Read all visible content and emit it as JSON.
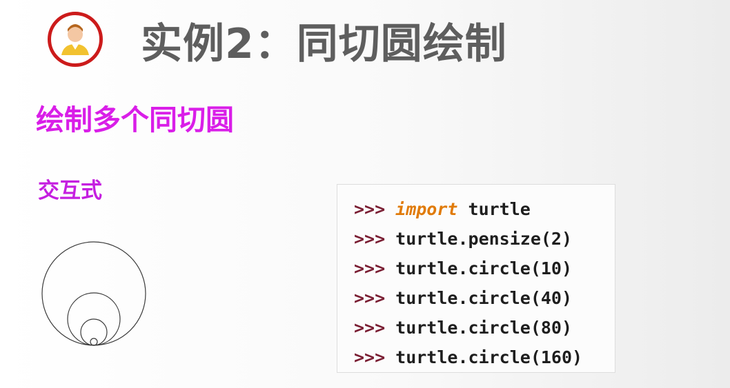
{
  "header": {
    "title": "实例2：同切圆绘制"
  },
  "section": {
    "heading": "绘制多个同切圆",
    "mode_label": "交互式"
  },
  "code": {
    "prompt": ">>>",
    "lines": [
      {
        "keyword": "import",
        "text": " turtle"
      },
      {
        "keyword": "",
        "text": "turtle.pensize(2)"
      },
      {
        "keyword": "",
        "text": "turtle.circle(10)"
      },
      {
        "keyword": "",
        "text": "turtle.circle(40)"
      },
      {
        "keyword": "",
        "text": "turtle.circle(80)"
      },
      {
        "keyword": "",
        "text": "turtle.circle(160)"
      }
    ]
  },
  "colors": {
    "title": "#5e5e5e",
    "heading": "#d91ee8",
    "avatar_ring": "#cc1b1b",
    "prompt": "#7a1e33",
    "keyword": "#e07b0a"
  },
  "icons": {
    "avatar": "user-avatar-icon"
  }
}
